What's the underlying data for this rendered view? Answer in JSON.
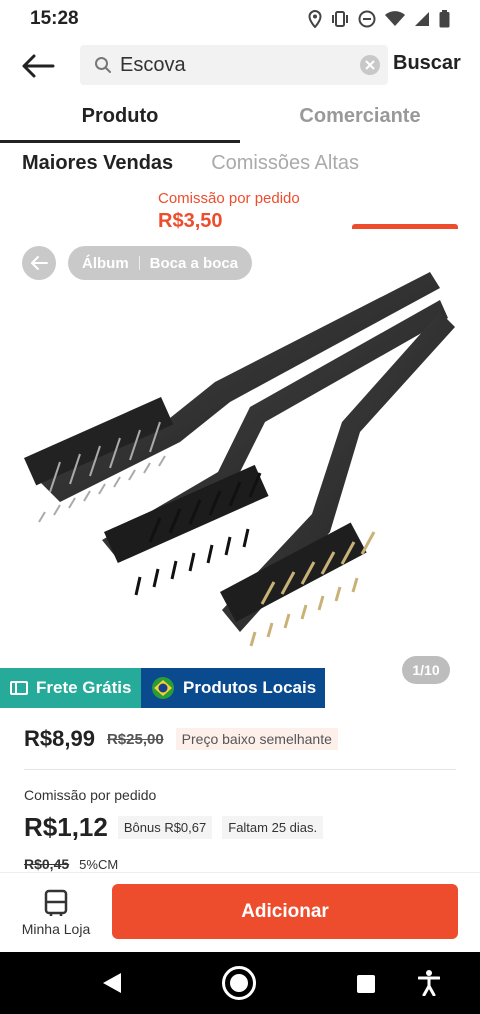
{
  "status_bar": {
    "time": "15:28",
    "icons": [
      "location-icon",
      "vibrate-icon",
      "dnd-icon",
      "wifi-icon",
      "signal-icon",
      "battery-icon"
    ]
  },
  "search": {
    "query": "Escova",
    "submit_label": "Buscar"
  },
  "tabs": [
    {
      "label": "Produto",
      "active": true
    },
    {
      "label": "Comerciante",
      "active": false
    }
  ],
  "sort": {
    "options": [
      "Maiores Vendas",
      "Comissões Altas"
    ],
    "active": "Maiores Vendas"
  },
  "peek_card": {
    "commission_label": "Comissão por pedido",
    "commission_value": "R$3,50"
  },
  "gallery": {
    "pill_items": [
      "Álbum",
      "Boca a boca"
    ],
    "counter": "1/10"
  },
  "badges": {
    "free_shipping": "Frete Grátis",
    "local_products": "Produtos Locais"
  },
  "price": {
    "current": "R$8,99",
    "original": "R$25,00",
    "tag": "Preço baixo semelhante"
  },
  "commission": {
    "label": "Comissão por pedido",
    "value": "R$1,12",
    "bonus": "Bônus R$0,67",
    "remaining": "Faltam 25 dias.",
    "old_value": "R$0,45",
    "percent": "5%CM"
  },
  "bottom_bar": {
    "store_label": "Minha Loja",
    "add_label": "Adicionar"
  },
  "colors": {
    "accent": "#ee4d2d",
    "free_shipping": "#26aa99",
    "local_products": "#0a4a8f"
  }
}
